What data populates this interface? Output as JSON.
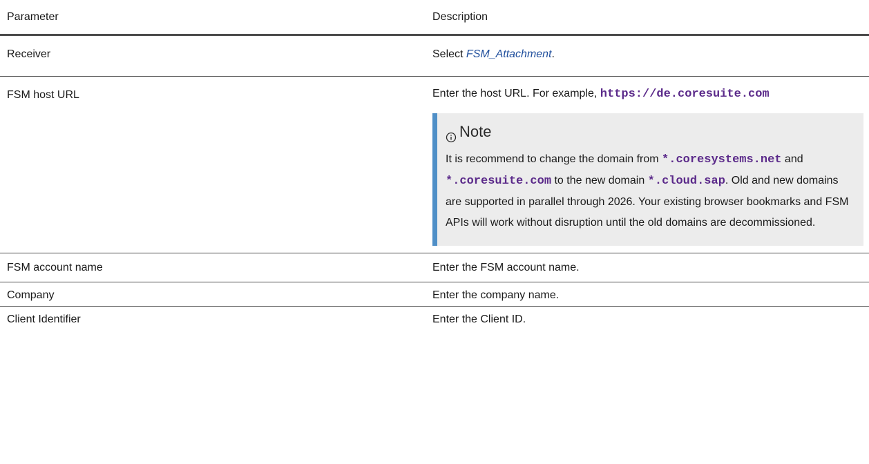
{
  "header": {
    "parameter": "Parameter",
    "description": "Description"
  },
  "rows": {
    "receiver": {
      "param": "Receiver",
      "desc_prefix": "Select ",
      "desc_link": "FSM_Attachment",
      "desc_suffix": "."
    },
    "fsm_host_url": {
      "param": "FSM host URL",
      "desc_prefix": "Enter the host URL. For example, ",
      "desc_code": "https://de.coresuite.com",
      "note": {
        "title": "Note",
        "icon": "info-icon",
        "text_1": "It is recommend to change the domain from ",
        "code_1": "*.coresystems.net",
        "text_2": " and ",
        "code_2": "*.coresuite.com",
        "text_3": " to the new domain ",
        "code_3": "*.cloud.sap",
        "text_4": ". Old and new domains are supported in parallel through 2026. Your existing browser bookmarks and FSM APIs will work without disruption until the old domains are decommissioned."
      }
    },
    "fsm_account_name": {
      "param": "FSM account name",
      "desc": "Enter the FSM account name."
    },
    "company": {
      "param": "Company",
      "desc": "Enter the company name."
    },
    "client_identifier": {
      "param": "Client Identifier",
      "desc": "Enter the Client ID."
    }
  },
  "colors": {
    "link": "#1f4e9c",
    "code": "#5b2a8a",
    "note_border": "#4f8fc7",
    "note_bg": "#ececec"
  }
}
